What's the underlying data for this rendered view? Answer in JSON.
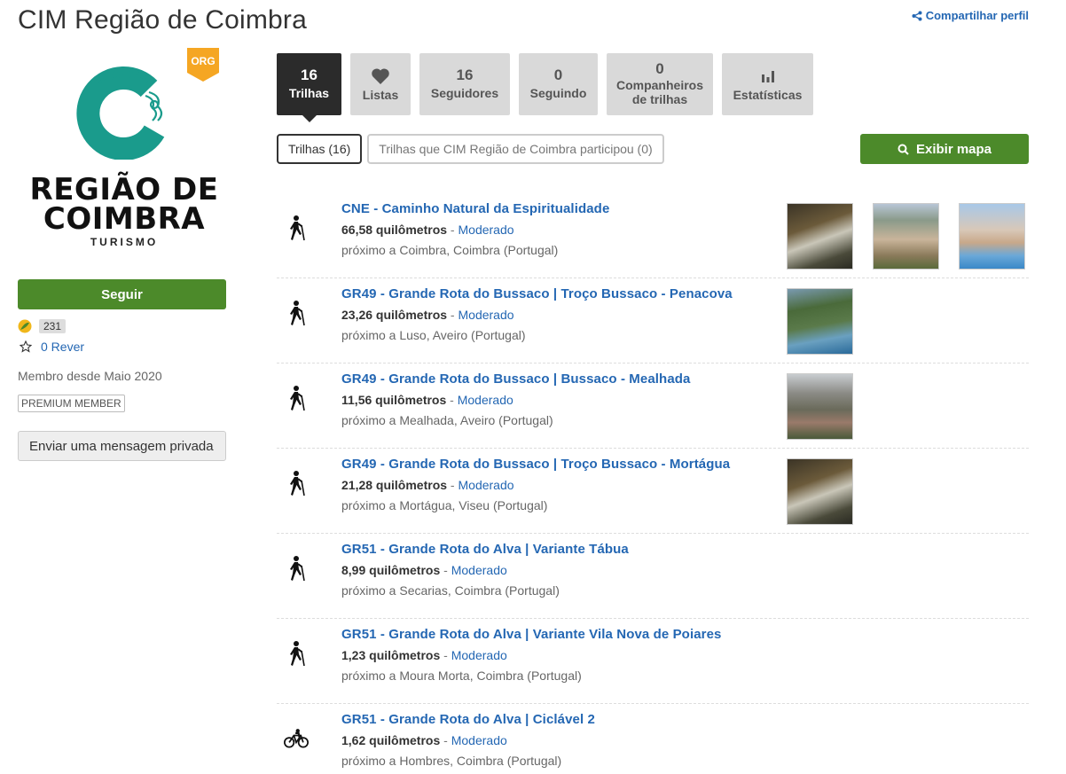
{
  "header": {
    "title": "CIM Região de Coimbra",
    "share_label": "Compartilhar perfil"
  },
  "profile": {
    "org_badge": "ORG",
    "logo_line1": "REGIÃO DE",
    "logo_line2": "COIMBRA",
    "logo_line3": "TURISMO",
    "follow_label": "Seguir",
    "rank": "231",
    "reviews": "0 Rever",
    "member_since": "Membro desde Maio 2020",
    "premium": "PREMIUM MEMBER",
    "message_label": "Enviar uma mensagem privada",
    "brand_color": "#1a9b8c"
  },
  "tabs": [
    {
      "num": "16",
      "label": "Trilhas",
      "active": true
    },
    {
      "icon": "heart-icon",
      "label": "Listas"
    },
    {
      "num": "16",
      "label": "Seguidores"
    },
    {
      "num": "0",
      "label": "Seguindo"
    },
    {
      "num": "0",
      "label_line1": "Companheiros",
      "label_line2": "de trilhas"
    },
    {
      "icon": "bar-chart-icon",
      "label": "Estatísticas"
    }
  ],
  "subtabs": {
    "trails": "Trilhas (16)",
    "participated": "Trilhas que CIM Região de Coimbra participou (0)"
  },
  "map_button": "Exibir mapa",
  "trails": [
    {
      "name": "CNE - Caminho Natural da Espiritualidade",
      "distance": "66,58 quilômetros",
      "difficulty": "Moderado",
      "location": "próximo a Coimbra, Coimbra (Portugal)",
      "activity": "hiking-icon",
      "thumbs": 3
    },
    {
      "name": "GR49 - Grande Rota do Bussaco | Troço Bussaco - Penacova",
      "distance": "23,26 quilômetros",
      "difficulty": "Moderado",
      "location": "próximo a Luso, Aveiro (Portugal)",
      "activity": "hiking-icon",
      "thumbs": 1
    },
    {
      "name": "GR49 - Grande Rota do Bussaco | Bussaco - Mealhada",
      "distance": "11,56 quilômetros",
      "difficulty": "Moderado",
      "location": "próximo a Mealhada, Aveiro (Portugal)",
      "activity": "hiking-icon",
      "thumbs": 1
    },
    {
      "name": "GR49 - Grande Rota do Bussaco | Troço Bussaco - Mortágua",
      "distance": "21,28 quilômetros",
      "difficulty": "Moderado",
      "location": "próximo a Mortágua, Viseu (Portugal)",
      "activity": "hiking-icon",
      "thumbs": 1
    },
    {
      "name": "GR51 - Grande Rota do Alva | Variante Tábua",
      "distance": "8,99 quilômetros",
      "difficulty": "Moderado",
      "location": "próximo a Secarias, Coimbra (Portugal)",
      "activity": "hiking-icon",
      "thumbs": 0
    },
    {
      "name": "GR51 - Grande Rota do Alva | Variante Vila Nova de Poiares",
      "distance": "1,23 quilômetros",
      "difficulty": "Moderado",
      "location": "próximo a Moura Morta, Coimbra (Portugal)",
      "activity": "hiking-icon",
      "thumbs": 0
    },
    {
      "name": "GR51 - Grande Rota do Alva | Ciclável 2",
      "distance": "1,62 quilômetros",
      "difficulty": "Moderado",
      "location": "próximo a Hombres, Coimbra (Portugal)",
      "activity": "cycling-icon",
      "thumbs": 0
    }
  ],
  "colors": {
    "accent_green": "#4c8a2a",
    "link_blue": "#2467b3",
    "badge_orange": "#f5a623"
  }
}
